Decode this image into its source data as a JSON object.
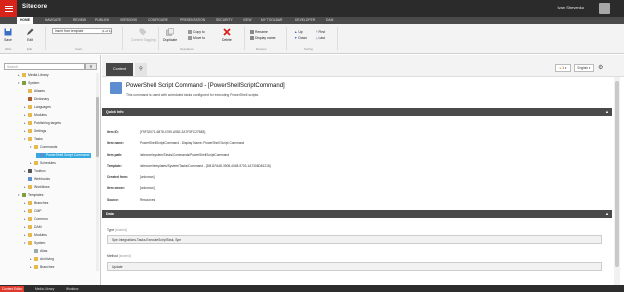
{
  "app": {
    "title": "Sitecore",
    "user": "Ivan Shevenko"
  },
  "ribbon_tabs": [
    {
      "label": "HOME",
      "active": true
    },
    {
      "label": "NAVIGATE"
    },
    {
      "label": "REVIEW"
    },
    {
      "label": "PUBLISH"
    },
    {
      "label": "VERSIONS"
    },
    {
      "label": "CONFIGURE"
    },
    {
      "label": "PRESENTATION"
    },
    {
      "label": "SECURITY"
    },
    {
      "label": "VIEW"
    },
    {
      "label": "MY TOOLBAR"
    },
    {
      "label": "DEVELOPER"
    },
    {
      "label": "DAM"
    }
  ],
  "ribbon": {
    "save": "Save",
    "edit": "Edit",
    "insert_from_template": "Insert from template",
    "insert_count": "(1 of 1)",
    "duplicate": "Duplicate",
    "copy_to": "Copy to",
    "move_to": "Move to",
    "delete": "Delete",
    "rename": "Rename",
    "display_name": "Display name",
    "up": "Up",
    "down": "Down",
    "first": "First",
    "last": "Last",
    "content_tagging": "Content Tagging",
    "group_write": "Write",
    "group_edit": "Edit",
    "group_insert": "Insert",
    "group_operations": "Operations",
    "group_rename": "Rename",
    "group_sorting": "Sorting"
  },
  "search": {
    "placeholder": "Search"
  },
  "tree": [
    {
      "label": "Media Library",
      "level": 0
    },
    {
      "label": "System",
      "level": 0,
      "expanded": true
    },
    {
      "label": "Aliases",
      "level": 1
    },
    {
      "label": "Dictionary",
      "level": 1
    },
    {
      "label": "Languages",
      "level": 1
    },
    {
      "label": "Modules",
      "level": 1
    },
    {
      "label": "Publishing targets",
      "level": 1
    },
    {
      "label": "Settings",
      "level": 1
    },
    {
      "label": "Tasks",
      "level": 1,
      "expanded": true
    },
    {
      "label": "Commands",
      "level": 2,
      "expanded": true
    },
    {
      "label": "PowerShell Script Command",
      "level": 3,
      "selected": true
    },
    {
      "label": "Schedules",
      "level": 2
    },
    {
      "label": "Toolbox",
      "level": 1
    },
    {
      "label": "Webhooks",
      "level": 1
    },
    {
      "label": "Workflows",
      "level": 1
    },
    {
      "label": "Templates",
      "level": 0,
      "expanded": true
    },
    {
      "label": "Branches",
      "level": 1
    },
    {
      "label": "CMP",
      "level": 1
    },
    {
      "label": "Common",
      "level": 1
    },
    {
      "label": "DAM",
      "level": 1
    },
    {
      "label": "Modules",
      "level": 1
    },
    {
      "label": "System",
      "level": 1,
      "expanded": true
    },
    {
      "label": "Alias",
      "level": 2
    },
    {
      "label": "Archiving",
      "level": 2
    },
    {
      "label": "Branches",
      "level": 2
    }
  ],
  "bottom_tabs": [
    {
      "label": "Content Editor",
      "active": true
    },
    {
      "label": "Media Library"
    },
    {
      "label": "Workbox"
    }
  ],
  "content_tabs": {
    "content": "Content"
  },
  "toolbar_right": {
    "version": "1",
    "language": "English"
  },
  "item": {
    "title": "PowerShell Script Command - [PowerShellScriptCommand]",
    "subtitle": "This command is used with scheduled tasks configured for executing PowerShell scripts."
  },
  "quick_info": {
    "header": "Quick Info",
    "rows": [
      {
        "key": "Item ID:",
        "value": "{F5F32071-6878-4769-A982-2A7F5FC27B83}"
      },
      {
        "key": "Item name:",
        "value": "PowerShellScriptCommand - Display Name: PowerShell Script Command"
      },
      {
        "key": "Item path:",
        "value": "/sitecore/system/Tasks/Commands/PowerShellScriptCommand"
      },
      {
        "key": "Template:",
        "value": "/sitecore/templates/System/Tasks/Command - {DB11FA48-3908-4048-9703-1A7306D81218}"
      },
      {
        "key": "Created from:",
        "value": "[unknown]"
      },
      {
        "key": "Item owner:",
        "value": "[unknown]"
      },
      {
        "key": "Source:",
        "value": "Resources"
      }
    ]
  },
  "data_section": {
    "header": "Data",
    "type_label": "Type",
    "type_shared": "[shared]",
    "type_value": "Spe.Integrations.Tasks.ExecuteScriptTask, Spe",
    "method_label": "Method",
    "method_shared": "[shared]",
    "method_value": "Update"
  },
  "colors": {
    "accent": "#d8231b",
    "selection": "#34a8e0",
    "header_dark": "#2b2b2b",
    "section": "#4a4a4a"
  }
}
